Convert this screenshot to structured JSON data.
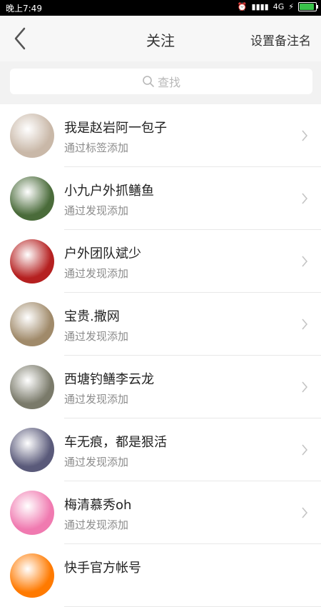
{
  "status_bar": {
    "time": "晚上7:49",
    "network": "4G",
    "battery_level": 0.9
  },
  "header": {
    "title": "关注",
    "right_action": "设置备注名"
  },
  "search": {
    "placeholder": "查找"
  },
  "follow_list": [
    {
      "name": "我是赵岩阿一包子",
      "source": "通过标签添加",
      "avatar_color": "#c9b8a8"
    },
    {
      "name": "小九户外抓鳝鱼",
      "source": "通过发现添加",
      "avatar_color": "#4a6b3a"
    },
    {
      "name": "户外团队斌少",
      "source": "通过发现添加",
      "avatar_color": "#b52020"
    },
    {
      "name": "宝贵.撒网",
      "source": "通过发现添加",
      "avatar_color": "#a08a6a"
    },
    {
      "name": "西塘钓鳝李云龙",
      "source": "通过发现添加",
      "avatar_color": "#7a7a6a"
    },
    {
      "name": "车无痕，都是狠活",
      "source": "通过发现添加",
      "avatar_color": "#5a5a7a"
    },
    {
      "name": "梅清慕秀oh",
      "source": "通过发现添加",
      "avatar_color": "#f07ab0"
    },
    {
      "name": "快手官方帐号",
      "source": "",
      "avatar_color": "#ff7a00"
    }
  ],
  "colors": {
    "divider": "#e8e8e8",
    "secondary_text": "#8c8c8c",
    "primary_text": "#222222"
  }
}
